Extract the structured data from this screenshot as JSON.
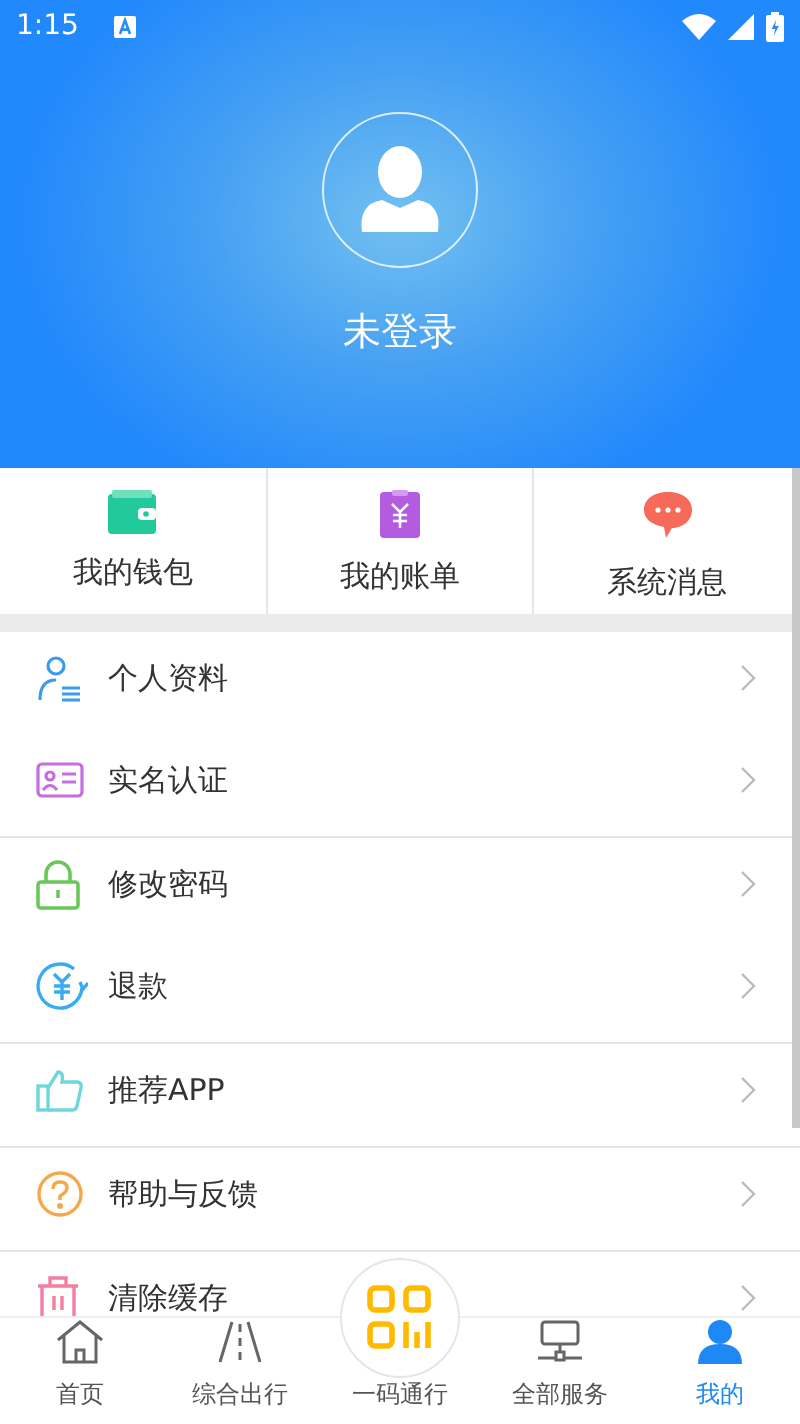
{
  "status_bar": {
    "time": "1:15"
  },
  "profile": {
    "name": "未登录"
  },
  "shortcuts": [
    {
      "kind": "wallet",
      "label": "我的钱包"
    },
    {
      "kind": "bill",
      "label": "我的账单"
    },
    {
      "kind": "message",
      "label": "系统消息"
    }
  ],
  "menu_groups": [
    [
      {
        "kind": "profile",
        "label": "个人资料"
      },
      {
        "kind": "idcard",
        "label": "实名认证"
      }
    ],
    [
      {
        "kind": "lock",
        "label": "修改密码"
      },
      {
        "kind": "refund",
        "label": "退款"
      }
    ],
    [
      {
        "kind": "thumb",
        "label": "推荐APP"
      }
    ],
    [
      {
        "kind": "help",
        "label": "帮助与反馈"
      }
    ],
    [
      {
        "kind": "trash",
        "label": "清除缓存"
      }
    ]
  ],
  "tabs": [
    {
      "kind": "home",
      "label": "首页",
      "selected": false
    },
    {
      "kind": "road",
      "label": "综合出行",
      "selected": false
    },
    {
      "kind": "code",
      "label": "一码通行",
      "selected": false
    },
    {
      "kind": "services",
      "label": "全部服务",
      "selected": false
    },
    {
      "kind": "me",
      "label": "我的",
      "selected": true
    }
  ]
}
